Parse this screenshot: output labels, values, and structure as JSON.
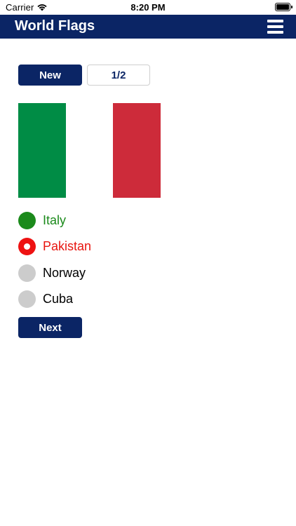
{
  "status_bar": {
    "carrier": "Carrier",
    "time": "8:20 PM",
    "wifi_icon": "wifi-icon",
    "battery_icon": "battery-icon"
  },
  "nav": {
    "title": "World Flags",
    "menu_icon": "hamburger-menu-icon",
    "background_color": "#0b2565"
  },
  "controls": {
    "new_label": "New",
    "counter": "1/2"
  },
  "flag": {
    "stripes": [
      "#008c45",
      "#ffffff",
      "#cd2b3a"
    ]
  },
  "options": [
    {
      "label": "Italy",
      "state": "correct",
      "text_color": "#1b8a1b",
      "radio_color": "#1b8a1b"
    },
    {
      "label": "Pakistan",
      "state": "selected-wrong",
      "text_color": "#e8150f",
      "radio_color": "#ee1212"
    },
    {
      "label": "Norway",
      "state": "unselected",
      "text_color": "#000000",
      "radio_color": "#cccccc"
    },
    {
      "label": "Cuba",
      "state": "unselected",
      "text_color": "#000000",
      "radio_color": "#cccccc"
    }
  ],
  "next_label": "Next"
}
